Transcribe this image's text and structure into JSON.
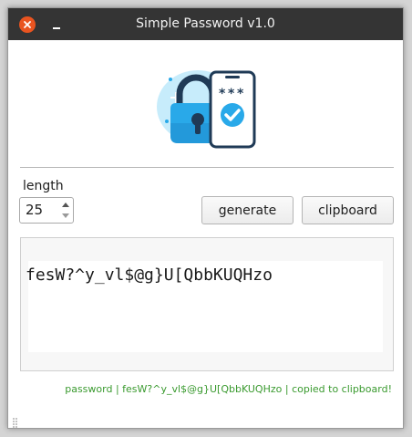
{
  "window": {
    "title": "Simple Password v1.0"
  },
  "controls": {
    "length_label": "length",
    "length_value": "25",
    "generate_label": "generate",
    "clipboard_label": "clipboard"
  },
  "output": {
    "password": "fesW?^y_vl$@g}U[QbbKUQHzo"
  },
  "status": {
    "message": "password | fesW?^y_vl$@g}U[QbbKUQHzo | copied to clipboard!"
  },
  "icons": [
    "close-icon",
    "minimize-icon",
    "padlock-phone-logo",
    "spin-up-icon",
    "spin-down-icon",
    "resize-grip-icon"
  ],
  "colors": {
    "titlebar": "#343434",
    "close_button": "#e95420",
    "status_text": "#3a9a2f",
    "logo_blue": "#29a9e9"
  }
}
